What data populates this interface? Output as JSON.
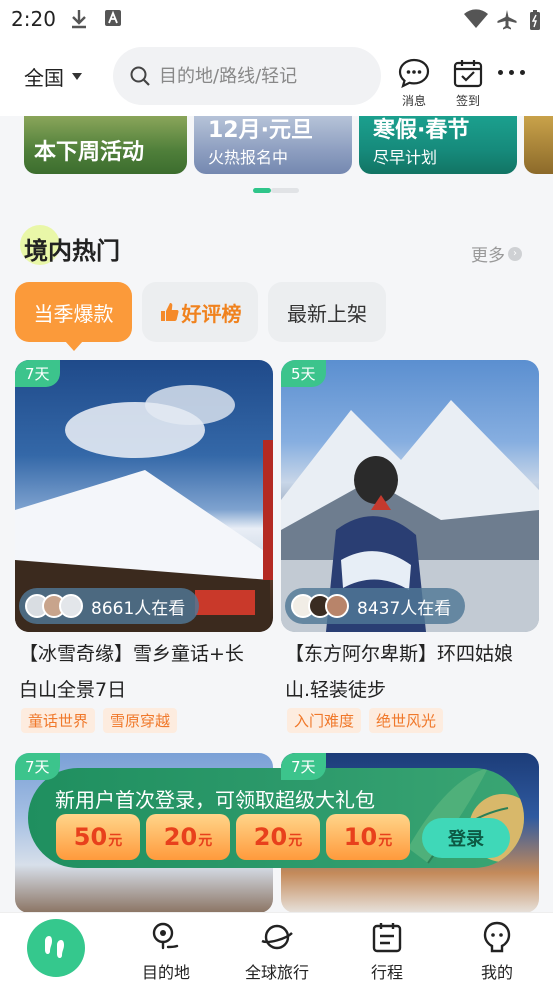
{
  "status_bar": {
    "time": "2:20"
  },
  "header": {
    "region": "全国",
    "search_placeholder": "目的地/路线/轻记",
    "message_label": "消息",
    "checkin_label": "签到"
  },
  "banner": [
    {
      "title": "本下周活动",
      "subtitle": ""
    },
    {
      "title": "12月·元旦",
      "subtitle": "火热报名中"
    },
    {
      "title": "寒假·春节",
      "subtitle": "尽早计划"
    }
  ],
  "section": {
    "title": "境内热门",
    "more": "更多"
  },
  "tabs": [
    {
      "label": "当季爆款",
      "active": true
    },
    {
      "label": "好评榜",
      "active": false
    },
    {
      "label": "最新上架",
      "active": false
    }
  ],
  "products": [
    {
      "days": "7天",
      "watching": "8661人在看",
      "title_line1": "【冰雪奇缘】雪乡童话+长",
      "title_line2": "白山全景7日",
      "tags": [
        "童话世界",
        "雪原穿越"
      ]
    },
    {
      "days": "5天",
      "watching": "8437人在看",
      "title_line1": "【东方阿尔卑斯】环四姑娘",
      "title_line2": "山.轻装徒步",
      "tags": [
        "入门难度",
        "绝世风光"
      ]
    }
  ],
  "products_row2": [
    {
      "days": "7天"
    },
    {
      "days": "7天"
    }
  ],
  "promo": {
    "text": "新用户首次登录，可领取超级大礼包",
    "coupons": [
      {
        "amount": "50",
        "unit": "元"
      },
      {
        "amount": "20",
        "unit": "元"
      },
      {
        "amount": "20",
        "unit": "元"
      },
      {
        "amount": "10",
        "unit": "元"
      }
    ],
    "login_label": "登录"
  },
  "bottom_nav": {
    "items": [
      "目的地",
      "全球旅行",
      "行程",
      "我的"
    ]
  },
  "colors": {
    "brand_green": "#35c88d",
    "accent_orange": "#fb9a3a",
    "tag_orange": "#f0782a"
  }
}
